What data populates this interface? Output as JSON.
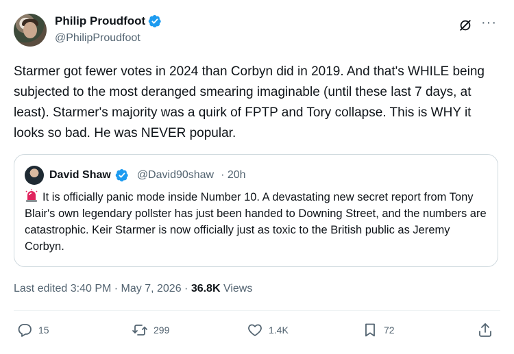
{
  "author": {
    "name": "Philip Proudfoot",
    "handle": "@PhilipProudfoot"
  },
  "tweet": {
    "text": "Starmer got fewer votes in 2024 than Corbyn did in 2019. And that's WHILE being subjected to the most deranged smearing imaginable (until these last 7 days, at least). Starmer's majority was a quirk of FPTP and Tory collapse. This is WHY it looks so bad. He was NEVER popular."
  },
  "quote": {
    "name": "David Shaw",
    "handle": "@David90shaw",
    "time": "· 20h",
    "text": "It is officially panic mode inside Number 10. A devastating new secret report from Tony Blair's own legendary pollster has just been handed to Downing Street, and the numbers are catastrophic. Keir Starmer is now officially just as toxic to the British public as Jeremy Corbyn."
  },
  "meta": {
    "edited": "Last edited 3:40 PM · May 7, 2026 ·",
    "views_count": "36.8K",
    "views_label": "Views"
  },
  "actions": {
    "replies": "15",
    "reposts": "299",
    "likes": "1.4K",
    "bookmarks": "72"
  },
  "colors": {
    "verified": "#1d9bf0",
    "secondary_text": "#536471",
    "siren": "#e0245e"
  },
  "icons": [
    "verified-badge-icon",
    "grok-icon",
    "more-icon",
    "siren-icon",
    "reply-icon",
    "repost-icon",
    "like-icon",
    "bookmark-icon",
    "share-icon"
  ]
}
